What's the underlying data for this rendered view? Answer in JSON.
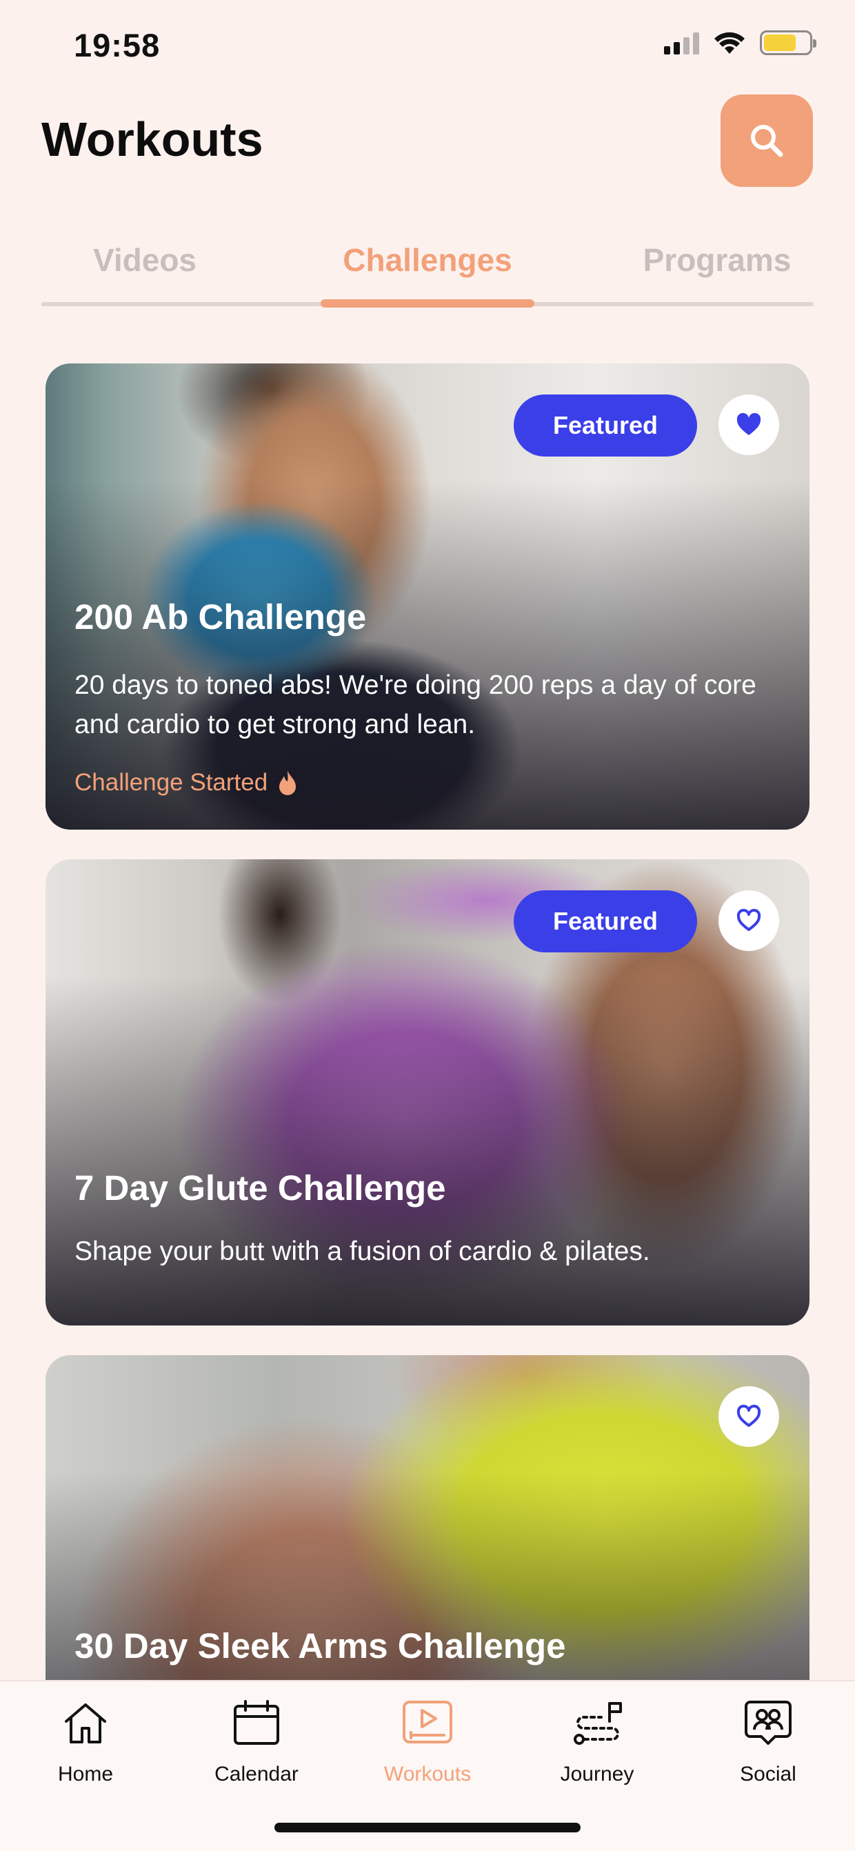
{
  "status_bar": {
    "time": "19:58"
  },
  "header": {
    "title": "Workouts"
  },
  "icons": {
    "search": "search-icon",
    "heart_filled": "heart-filled-icon",
    "heart_outline": "heart-outline-icon",
    "flame": "flame-icon"
  },
  "tabs": [
    {
      "label": "Videos",
      "active": false
    },
    {
      "label": "Challenges",
      "active": true
    },
    {
      "label": "Programs",
      "active": false
    }
  ],
  "cards": [
    {
      "title": "200 Ab Challenge",
      "description": "20 days to toned abs! We're doing 200 reps a day of core and cardio to get strong and lean.",
      "badge": "Featured",
      "favorited": true,
      "status": "Challenge Started"
    },
    {
      "title": "7 Day Glute Challenge",
      "description": "Shape your butt with a fusion of cardio & pilates.",
      "badge": "Featured",
      "favorited": false
    },
    {
      "title": "30 Day Sleek Arms Challenge",
      "favorited": false
    }
  ],
  "bottom_nav": [
    {
      "label": "Home",
      "icon": "home-icon",
      "active": false
    },
    {
      "label": "Calendar",
      "icon": "calendar-icon",
      "active": false
    },
    {
      "label": "Workouts",
      "icon": "workouts-icon",
      "active": true
    },
    {
      "label": "Journey",
      "icon": "journey-icon",
      "active": false
    },
    {
      "label": "Social",
      "icon": "social-icon",
      "active": false
    }
  ],
  "colors": {
    "accent": "#f2a17a",
    "featured": "#3a3fe8",
    "background": "#fdf1ee"
  }
}
